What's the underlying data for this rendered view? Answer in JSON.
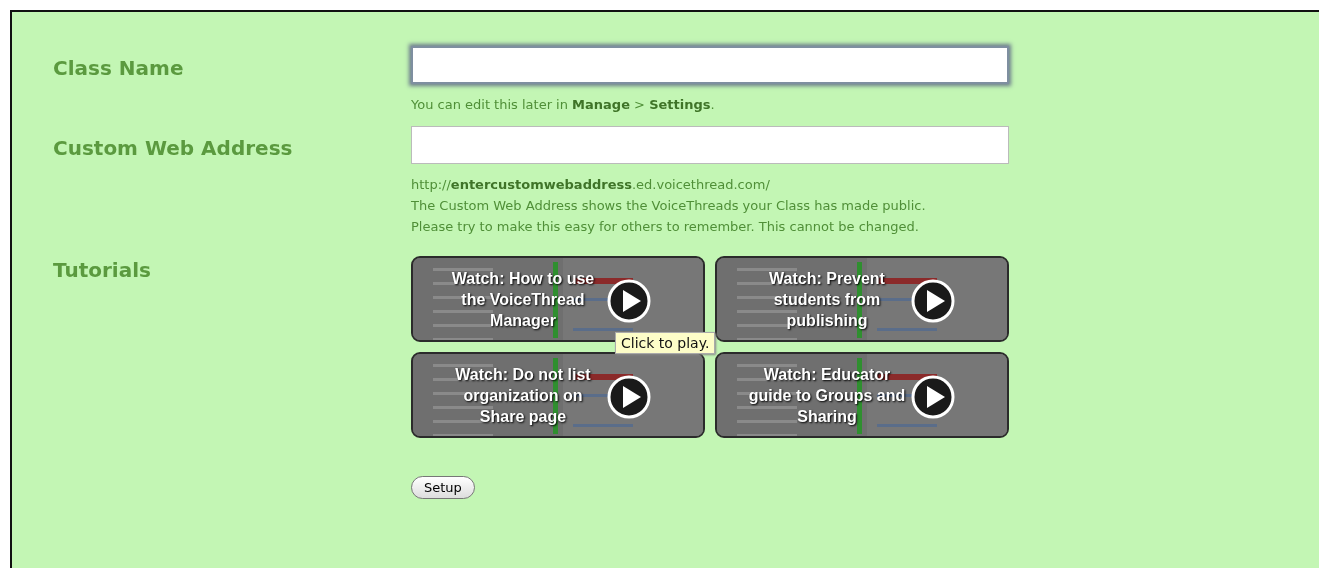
{
  "form": [
    {
      "kind": "text",
      "label": "Class Name",
      "focused": true,
      "notes": [
        "You can edit this later in **Manage** > **Settings**."
      ]
    },
    {
      "kind": "text",
      "label": "Custom Web Address",
      "focused": false,
      "notes": [
        "http://**entercustomwebaddress**.ed.voicethread.com/",
        "The Custom Web Address shows the VoiceThreads your Class has made public.",
        "Please try to make this easy for others to remember. This cannot be changed."
      ]
    }
  ],
  "tutorials": {
    "label": "Tutorials",
    "videos": [
      {
        "title": "Watch: How to use the VoiceThread Manager",
        "kind": "picture"
      },
      {
        "title": "Watch: Prevent students from publishing",
        "kind": "picture"
      },
      {
        "title": "Watch: Do not list organization on Share page",
        "kind": "picture"
      },
      {
        "title": "Watch: Educator guide to Groups and Sharing",
        "kind": "picture"
      }
    ],
    "tooltip": "Click to play."
  },
  "button": "Setup"
}
